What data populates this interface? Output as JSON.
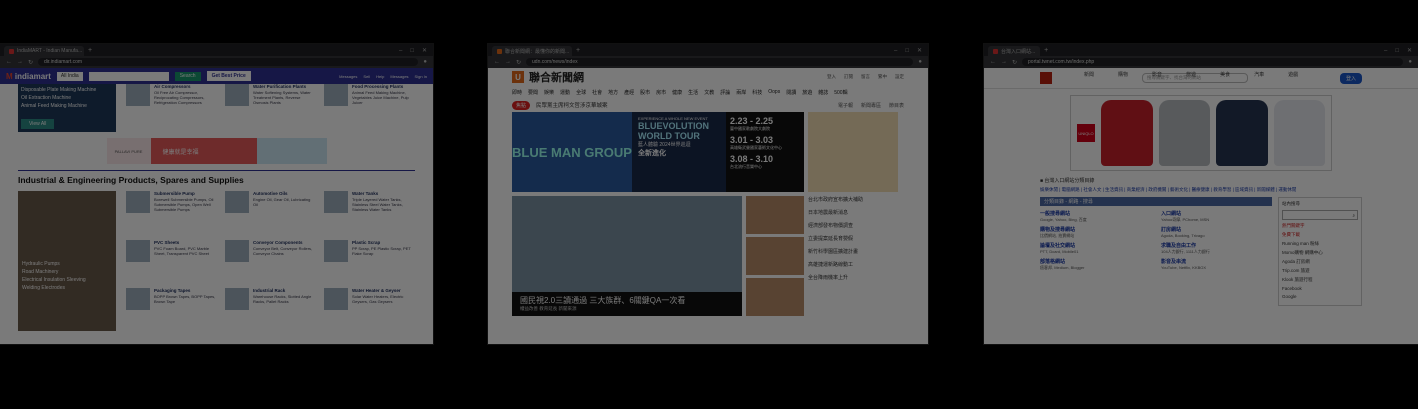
{
  "windows": [
    {
      "tab_title": "IndiaMART - Indian Manufa...",
      "url": "dir.indiamart.com",
      "profile": "",
      "site": {
        "logo": "indiamart",
        "select": "All India",
        "search_btn": "Search",
        "get_price": "Get Best Price",
        "nav": [
          "Messages",
          "Sell",
          "Help",
          "Messages",
          "Sign In"
        ],
        "left_items": [
          "Disposable Plate Making Machine",
          "Oil Extraction Machine",
          "Animal Feed Making Machine"
        ],
        "view_all": "View All",
        "cats": [
          {
            "title": "Air Compressors",
            "items": "Oil Free Air Compressor, Reciprocating Compressors, Refrigeration Compressors"
          },
          {
            "title": "Water Purification Plants",
            "items": "Water Softening Systems, Water Treatment Plants, Reverse Osmosis Plants"
          },
          {
            "title": "Food Processing Plants",
            "items": "Animal Feed Making Machine, Vegetables Juice Machine, Pulp Juicer"
          }
        ],
        "ad_texts": [
          "PALLAVI PURE",
          "健康就是幸福"
        ],
        "section_title": "Industrial & Engineering Products, Spares and Supplies",
        "left_items2": [
          "Hydraulic Pumps",
          "Road Machinery",
          "Electrical Insulation Sleeving",
          "Welding Electrodes"
        ],
        "cats2": [
          {
            "title": "Submersible Pump",
            "items": "Borewell Submersible Pumps, Oil Submersible Pumps, Open Well Submersible Pumps"
          },
          {
            "title": "Automotive Oils",
            "items": "Engine Oil, Gear Oil, Lubricating Oil"
          },
          {
            "title": "Water Tanks",
            "items": "Triple Layered Water Tanks, Stainless Steel Water Tanks, Stainless Water Tanks"
          },
          {
            "title": "PVC Sheets",
            "items": "PVC Foam Board, PVC Marble Sheet, Transparent PVC Sheet"
          },
          {
            "title": "Conveyor Components",
            "items": "Conveyor Belt, Conveyor Rollers, Conveyor Chains"
          },
          {
            "title": "Plastic Scrap",
            "items": "PP Scrap, PE Plastic Scrap, PET Flake Scrap"
          },
          {
            "title": "Packaging Tapes",
            "items": "BOPP Brown Tapes, BOPP Tapes, Brown Tape"
          },
          {
            "title": "Industrial Rack",
            "items": "Warehouse Racks, Slotted Angle Racks, Pallet Racks"
          },
          {
            "title": "Water Heater & Geyser",
            "items": "Solar Water Heaters, Electric Geysers, Gas Geysers"
          }
        ]
      }
    },
    {
      "tab_title": "聯合新聞網：最懂你的新聞...",
      "url": "udn.com/news/index",
      "profile": "",
      "site": {
        "logo_char": "U",
        "title": "聯合新聞網",
        "util": [
          "登入",
          "訂閱",
          "留言",
          "繁中",
          "設定"
        ],
        "nav": [
          "即時",
          "要聞",
          "娛樂",
          "運動",
          "全球",
          "社會",
          "地方",
          "產經",
          "股市",
          "房市",
          "健康",
          "生活",
          "文教",
          "評論",
          "兩岸",
          "科技",
          "Oops",
          "閱讀",
          "旅遊",
          "雜誌",
          "500輯"
        ],
        "badge": "焦點",
        "breaking": "民眾黨主席柯文哲涉京華城案",
        "mini": [
          "電子報",
          "新聞專區",
          "節目表"
        ],
        "banner": {
          "small": "EXPERIENCE A WHOLE NEW EVENT",
          "title": "BLUEVOLUTION WORLD TOUR",
          "sub": "藍人體驗 2024世界巡迴",
          "sub2": "全新進化",
          "d1": "2.23 - 2.25",
          "d1s": "臺中國家歌劇院大劇院",
          "d2": "3.01 - 3.03",
          "d2s": "高雄衛武營國家藝術文化中心",
          "d3": "3.08 - 3.10",
          "d3s": "台北流行音樂中心",
          "logo": "BLUE MAN GROUP"
        },
        "caption": "國民視2.0三讀通過 三大族群、6關鍵QA一次看",
        "caption_sub": "權益改善 教育延長 新聞來源",
        "news": [
          "台北市政府宣布擴大補助",
          "日本地震最新消息",
          "經濟部發布物價調查",
          "立委提案延長育嬰假",
          "新竹科學園區擴建計畫",
          "高雄捷運新路線動工",
          "全台降雨機率上升"
        ]
      }
    },
    {
      "tab_title": "台灣入口網站...",
      "url": "portal.twnet.com.tw/index.php",
      "profile": "",
      "site": {
        "tabs": [
          "新聞",
          "購物",
          "影音",
          "旅遊",
          "美食",
          "汽車",
          "遊戲"
        ],
        "search_ph": "搜尋關鍵字、找台灣的網站",
        "login": "登入",
        "ad_brand": "UNIQLO",
        "breadcrumb": "■ 台灣入口網站分類目錄",
        "links": "娛樂休閒 | 電腦網路 | 社會人文 | 生活資訊 | 商業經濟 | 政府機關 | 藝術文化 | 醫療健康 | 教育學習 | 區域資訊 | 新聞媒體 | 運動休閒",
        "bar": "分類目錄 - 網路 - 搜尋",
        "items": [
          {
            "title": "一般搜尋網站",
            "desc": "Google, Yahoo, Bing, 百度"
          },
          {
            "title": "入口網站",
            "desc": "Yahoo奇摩, PChome, MSN"
          },
          {
            "title": "購物及搜尋網站",
            "desc": "比價網站, 拍賣網站"
          },
          {
            "title": "訂房網站",
            "desc": "Agoda, Booking, Trivago"
          },
          {
            "title": "論壇及社交網站",
            "desc": "PTT, Dcard, Mobile01"
          },
          {
            "title": "求職及自由工作",
            "desc": "104人力銀行, 1111人力銀行"
          },
          {
            "title": "部落格網站",
            "desc": "痞客邦, Medium, Blogger"
          },
          {
            "title": "影音及串流",
            "desc": "YouTube, Netflix, KKBOX"
          }
        ],
        "side_title": "站內搜尋",
        "side_items": [
          "熱門關鍵字",
          "免費下載",
          "Running man 粉絲",
          "Momo購物 網購中心",
          "Agoda 訂房網",
          "Trip.com 旅遊",
          "Klook 旅遊行程",
          "Facebook",
          "Google"
        ]
      }
    }
  ]
}
